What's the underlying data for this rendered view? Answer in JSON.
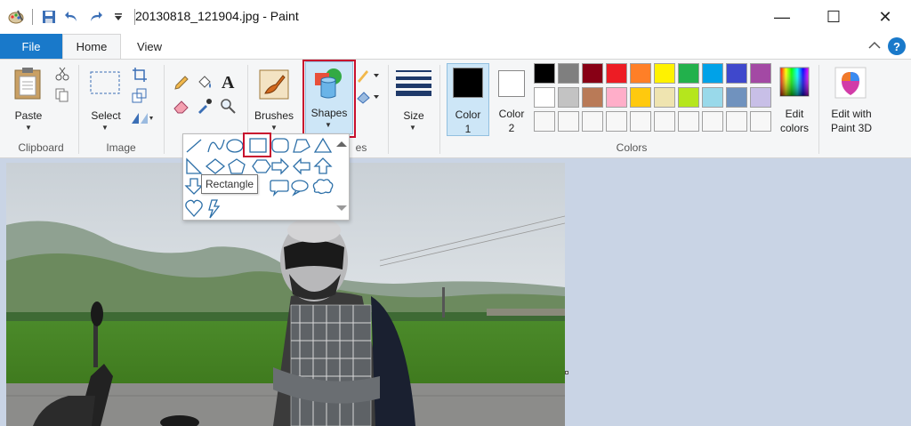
{
  "window": {
    "title": "20130818_121904.jpg - Paint",
    "minimize": "—",
    "maximize": "☐",
    "close": "✕"
  },
  "tabs": {
    "file": "File",
    "home": "Home",
    "view": "View"
  },
  "help": "?",
  "ribbon": {
    "clipboard": {
      "paste": "Paste",
      "label": "Clipboard"
    },
    "image": {
      "select": "Select",
      "label": "Image"
    },
    "brushes": "Brushes",
    "shapes": "Shapes",
    "shapes_group_label": "es",
    "size": "Size",
    "color1": {
      "label": "Color",
      "num": "1"
    },
    "color2": {
      "label": "Color",
      "num": "2"
    },
    "colors_label": "Colors",
    "edit_colors": {
      "line1": "Edit",
      "line2": "colors"
    },
    "paint3d": {
      "line1": "Edit with",
      "line2": "Paint 3D"
    }
  },
  "palette_row1": [
    "#000000",
    "#7f7f7f",
    "#880015",
    "#ed1c24",
    "#ff7f27",
    "#fff200",
    "#22b14c",
    "#00a2e8",
    "#3f48cc",
    "#a349a4"
  ],
  "palette_row2": [
    "#ffffff",
    "#c3c3c3",
    "#b97a57",
    "#ffaec9",
    "#ffc90e",
    "#efe4b0",
    "#b5e61d",
    "#99d9ea",
    "#7092be",
    "#c8bfe7"
  ],
  "colors": {
    "accent": "#1979ca",
    "highlight": "#c8102e",
    "color1": "#000000",
    "color2": "#ffffff"
  },
  "tooltip": "Rectangle"
}
